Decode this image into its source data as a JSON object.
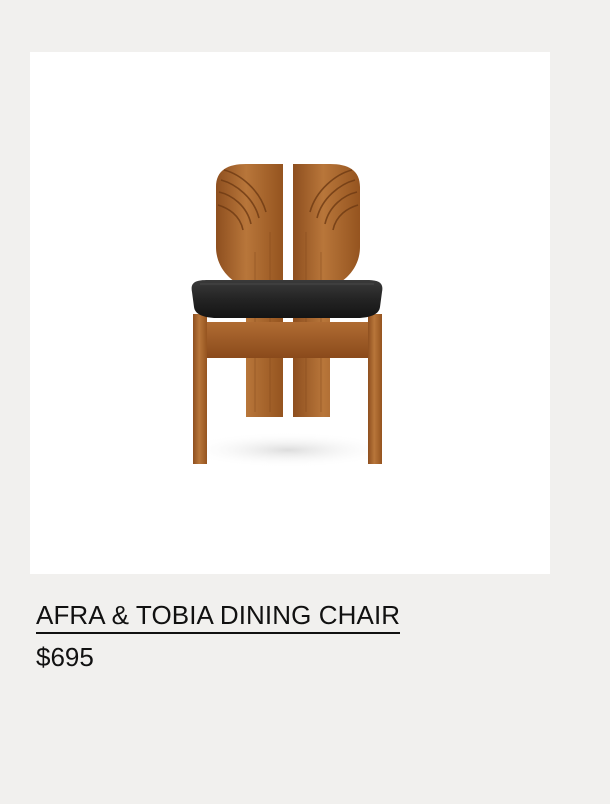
{
  "product": {
    "title": "AFRA & TOBIA DINING CHAIR",
    "price": "$695",
    "image_icon": "chair-image",
    "colors": {
      "page_background": "#f1f0ee",
      "image_background": "#ffffff",
      "text": "#111111",
      "wood": "#a4612b",
      "seat": "#252525"
    }
  }
}
